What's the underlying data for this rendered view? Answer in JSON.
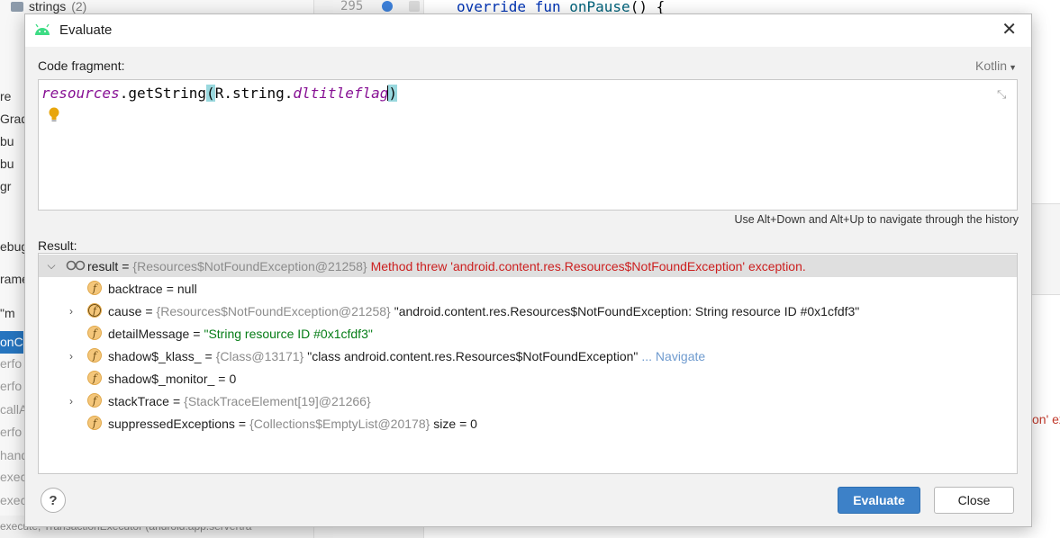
{
  "background": {
    "tree_top": {
      "label": "strings",
      "count": "(2)"
    },
    "editor": {
      "line_number": "295",
      "code": {
        "kw1": "override",
        "kw2": "fun",
        "fn": "onPause",
        "rest": "() {"
      }
    },
    "left_items": [
      {
        "text": "re",
        "style": "normal"
      },
      {
        "text": "Gradl",
        "style": "normal"
      },
      {
        "text": "bu",
        "style": "normal"
      },
      {
        "text": "bu",
        "style": "normal"
      },
      {
        "text": "gr",
        "style": "normal"
      },
      {
        "text": "ebug",
        "style": "normal"
      },
      {
        "text": "rame",
        "style": "normal"
      },
      {
        "text": "\"m",
        "style": "normal"
      },
      {
        "text": "onCr",
        "style": "selected"
      },
      {
        "text": "erfo",
        "style": "gray"
      },
      {
        "text": "erfo",
        "style": "gray"
      },
      {
        "text": "callA",
        "style": "gray"
      },
      {
        "text": "erfo",
        "style": "gray"
      },
      {
        "text": "hand",
        "style": "gray"
      },
      {
        "text": "exec",
        "style": "gray"
      },
      {
        "text": "exec",
        "style": "gray"
      }
    ],
    "bottom_strip": "execute, TransactionExecutor (android.app.servertra",
    "right_fragment": "on' ex"
  },
  "dialog": {
    "title": "Evaluate",
    "code_fragment_label": "Code fragment:",
    "language": "Kotlin",
    "code": {
      "receiver": "resources",
      "dot1": ".",
      "method": "getString",
      "open_paren": "(",
      "arg_prefix": "R.string.",
      "arg_field": "dltitleflag",
      "close_paren": ")"
    },
    "history_hint": "Use Alt+Down and Alt+Up to navigate through the history",
    "result_label": "Result:",
    "result": {
      "name": "result",
      "eq": "=",
      "ref": "{Resources$NotFoundException@21258}",
      "error": "Method threw 'android.content.res.Resources$NotFoundException' exception."
    },
    "fields": [
      {
        "name": "backtrace",
        "eq": "=",
        "value": "null",
        "value_style": "plain",
        "ref": "",
        "extra": "",
        "expandable": false,
        "badge": "f"
      },
      {
        "name": "cause",
        "eq": "=",
        "ref": "{Resources$NotFoundException@21258}",
        "value": "\"android.content.res.Resources$NotFoundException: String resource ID #0x1cfdf3\"",
        "value_style": "plain",
        "extra": "",
        "expandable": true,
        "badge": "f"
      },
      {
        "name": "detailMessage",
        "eq": "=",
        "ref": "",
        "value": "\"String resource ID #0x1cfdf3\"",
        "value_style": "string",
        "extra": "",
        "expandable": false,
        "badge": "f"
      },
      {
        "name": "shadow$_klass_",
        "eq": "=",
        "ref": "{Class@13171}",
        "value": "\"class android.content.res.Resources$NotFoundException\"",
        "value_style": "plain",
        "extra": "... Navigate",
        "expandable": true,
        "badge": "f"
      },
      {
        "name": "shadow$_monitor_",
        "eq": "=",
        "ref": "",
        "value": "0",
        "value_style": "plain",
        "extra": "",
        "expandable": false,
        "badge": "f"
      },
      {
        "name": "stackTrace",
        "eq": "=",
        "ref": "{StackTraceElement[19]@21266}",
        "value": "",
        "value_style": "plain",
        "extra": "",
        "expandable": true,
        "badge": "f"
      },
      {
        "name": "suppressedExceptions",
        "eq": "=",
        "ref": "{Collections$EmptyList@20178}",
        "value": "size = 0",
        "value_style": "plain",
        "extra": "",
        "expandable": false,
        "badge": "f"
      }
    ],
    "help_label": "?",
    "evaluate_label": "Evaluate",
    "close_label": "Close"
  },
  "colors": {
    "accent": "#3d81c8",
    "error": "#cc1f1f",
    "string": "#067d17",
    "badge": "#f4c67a",
    "selection": "#2675bf"
  }
}
